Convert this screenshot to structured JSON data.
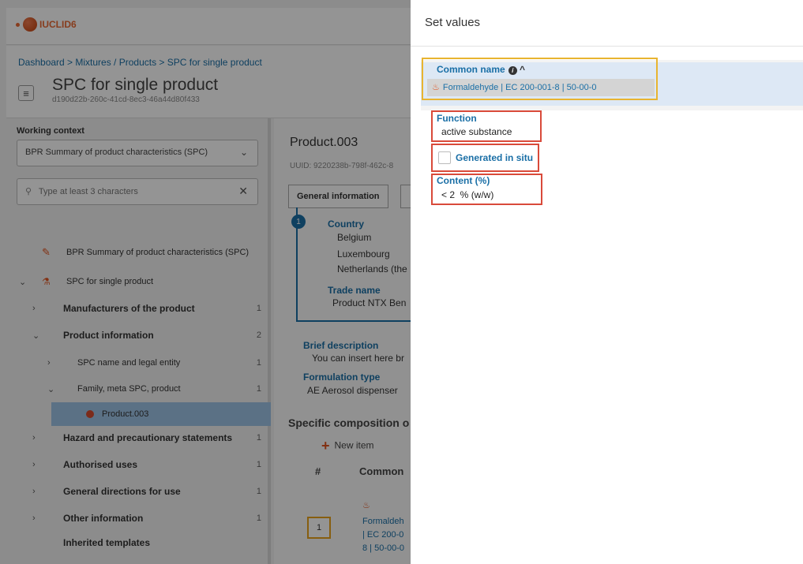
{
  "app": {
    "logo_text": "IUCLID6"
  },
  "header": {
    "breadcrumb": "Dashboard > Mixtures / Products > SPC for single product",
    "title": "SPC for single product",
    "uuid": "d190d22b-260c-41cd-8ec3-46a44d80f433"
  },
  "sidebar": {
    "working_context_label": "Working context",
    "working_context_value": "BPR Summary of product characteristics (SPC)",
    "search_placeholder": "Type at least 3 characters",
    "tree": [
      {
        "label": "BPR Summary of product characteristics (SPC)",
        "count": ""
      },
      {
        "label": "SPC for single product",
        "count": ""
      },
      {
        "label": "Manufacturers of the product",
        "count": "1"
      },
      {
        "label": "Product information",
        "count": "2"
      },
      {
        "label": "SPC name and legal entity",
        "count": "1"
      },
      {
        "label": "Family, meta SPC, product",
        "count": "1"
      },
      {
        "label": "Product.003",
        "count": ""
      },
      {
        "label": "Hazard and precautionary statements",
        "count": "1"
      },
      {
        "label": "Authorised uses",
        "count": "1"
      },
      {
        "label": "General directions for use",
        "count": "1"
      },
      {
        "label": "Other information",
        "count": "1"
      },
      {
        "label": "Inherited templates",
        "count": ""
      }
    ]
  },
  "content": {
    "title": "Product.003",
    "uuid": "UUID: 9220238b-798f-462c-8",
    "tab_general": "General information",
    "block_number": "1",
    "country_label": "Country",
    "countries": [
      "Belgium",
      "Luxembourg",
      "Netherlands (the"
    ],
    "trade_name_label": "Trade name",
    "trade_name_value": "Product NTX Ben",
    "brief_description_label": "Brief description",
    "brief_description_value": "You can insert here br",
    "formulation_type_label": "Formulation type",
    "formulation_type_value": "AE Aerosol dispenser",
    "section_title": "Specific composition o",
    "new_item_label": "New item",
    "col_hash": "#",
    "col_common": "Common",
    "row1": {
      "num": "1",
      "link_lines": [
        "Formaldeh",
        "| EC 200-0",
        "8 | 50-00-0"
      ]
    }
  },
  "dialog": {
    "title": "Set values",
    "common_name_label": "Common name",
    "common_name_value": "Formaldehyde | EC 200-001-8 | 50-00-0",
    "function_label": "Function",
    "function_value": "active substance",
    "generated_in_situ_label": "Generated in situ",
    "content_label": "Content (%)",
    "content_value": "< 2  % (w/w)"
  }
}
